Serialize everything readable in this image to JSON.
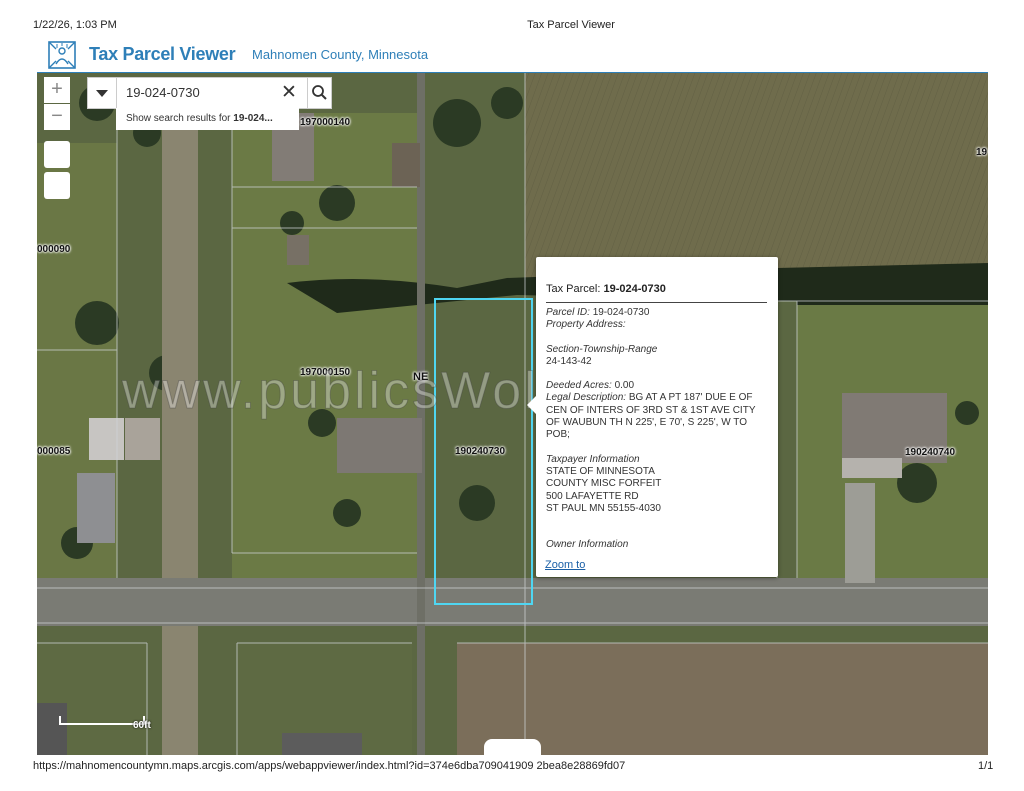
{
  "print_header": {
    "datetime": "1/22/26, 1:03 PM",
    "title": "Tax Parcel Viewer"
  },
  "app": {
    "title": "Tax Parcel Viewer",
    "subtitle": "Mahnomen County, Minnesota"
  },
  "map_controls": {
    "zoom_in": "+",
    "zoom_out": "−"
  },
  "search": {
    "value": "19-024-0730",
    "suggestion_prefix": "Show search results for ",
    "suggestion_term": "19-024..."
  },
  "map_labels": {
    "p1": "197000140",
    "p2": "19",
    "p3": "000090",
    "p4": "197000150",
    "p5": "NE",
    "p6": "190240730",
    "p7": "000085",
    "p8": "190240740",
    "scale": "60ft"
  },
  "watermark": "www.publicsWolus.com",
  "popup": {
    "title_prefix": "Tax Parcel: ",
    "title_value": "19-024-0730",
    "parcel_id_label": "Parcel ID:",
    "parcel_id_value": "19-024-0730",
    "property_address_label": "Property Address:",
    "str_label": "Section-Township-Range",
    "str_value": "24-143-42",
    "deeded_label": "Deeded Acres:",
    "deeded_value": "0.00",
    "legal_label": "Legal Description:",
    "legal_value": "BG AT A PT 187' DUE E OF CEN OF INTERS OF 3RD ST & 1ST AVE CITY OF WAUBUN TH N 225', E 70', S 225', W TO POB;",
    "taxpayer_label": "Taxpayer Information",
    "taxpayer_lines": [
      "STATE OF MINNESOTA",
      "COUNTY MISC FORFEIT",
      "500 LAFAYETTE RD",
      "ST PAUL MN 55155-4030"
    ],
    "owner_label": "Owner Information",
    "zoom_to": "Zoom to"
  },
  "footer": {
    "url": "https://mahnomencountymn.maps.arcgis.com/apps/webappviewer/index.html?id=374e6dba709041909 2bea8e28869fd07",
    "page": "1/1"
  },
  "colors": {
    "accent": "#2e7fb8",
    "selection": "#4fd6f2",
    "link": "#1a5fa6"
  },
  "icons": {
    "logo": "parcel-grid-logo-icon",
    "dropdown": "caret-down-icon",
    "clear": "close-icon",
    "search": "search-icon"
  }
}
